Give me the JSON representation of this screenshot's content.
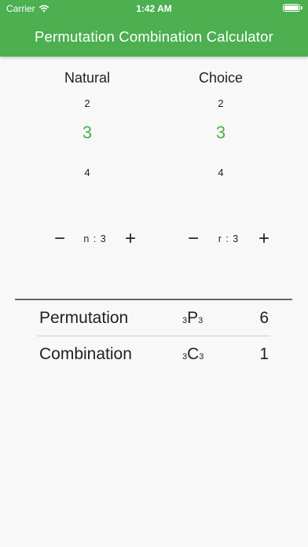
{
  "status_bar": {
    "carrier": "Carrier",
    "time": "1:42 AM"
  },
  "app_bar": {
    "title": "Permutation Combination Calculator",
    "color": "#4caf50"
  },
  "natural": {
    "title": "Natural",
    "prev": "2",
    "selected": "3",
    "next": "4",
    "stepper_label": "n : 3"
  },
  "choice": {
    "title": "Choice",
    "prev": "2",
    "selected": "3",
    "next": "4",
    "stepper_label": "r : 3"
  },
  "stepper_icons": {
    "minus": "−",
    "plus": "+"
  },
  "results": {
    "permutation": {
      "label": "Permutation",
      "pre_sub": "3",
      "symbol": "P",
      "post_sub": "3",
      "value": "6"
    },
    "combination": {
      "label": "Combination",
      "pre_sub": "3",
      "symbol": "C",
      "post_sub": "3",
      "value": "1"
    }
  }
}
